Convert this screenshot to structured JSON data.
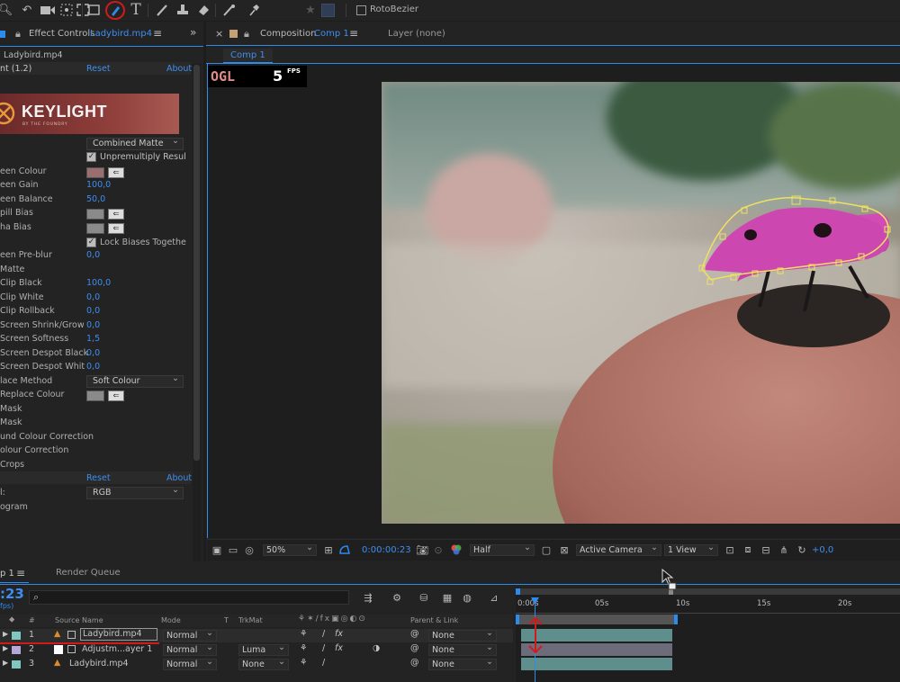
{
  "toolbar": {
    "rotobezier_label": "RotoBezier",
    "tools": [
      "magnify-icon",
      "undo-rotate-icon",
      "camera-icon",
      "pan-behind-icon",
      "anchor-icon",
      "rectangle-icon",
      "pen-icon",
      "type-icon",
      "brush-icon",
      "clone-stamp-icon",
      "eraser-icon",
      "roto-brush-icon",
      "puppet-pin-icon",
      "star-icon"
    ]
  },
  "effect_controls": {
    "tab_title": "Effect Controls",
    "tab_file": "Ladybird.mp4",
    "layer_name": "Ladybird.mp4",
    "effect_name": "nt (1.2)",
    "reset_label": "Reset",
    "about_label": "About",
    "logo_text": "KEYLIGHT",
    "logo_subtext": "BY THE FOUNDRY",
    "view_value": "Combined Matte",
    "unpremultiply_label": "Unpremultiply Resul",
    "rows": [
      {
        "label": "een Colour"
      },
      {
        "label": "een Gain",
        "value": "100,0"
      },
      {
        "label": "een Balance",
        "value": "50,0"
      },
      {
        "label": "pill Bias"
      },
      {
        "label": "ha Bias"
      },
      {
        "label": "Lock Biases Togethe"
      },
      {
        "label": "een Pre-blur",
        "value": "0,0"
      },
      {
        "label": "Matte"
      },
      {
        "label": "Clip Black",
        "value": "100,0"
      },
      {
        "label": "Clip White",
        "value": "0,0"
      },
      {
        "label": "Clip Rollback",
        "value": "0,0"
      },
      {
        "label": "Screen Shrink/Grow",
        "value": "0,0"
      },
      {
        "label": "Screen Softness",
        "value": "1,5"
      },
      {
        "label": "Screen Despot Black",
        "value": "0,0"
      },
      {
        "label": "Screen Despot Whit",
        "value": "0,0"
      },
      {
        "label": "lace Method"
      },
      {
        "label": "Replace Colour"
      },
      {
        "label": "Mask"
      },
      {
        "label": " Mask"
      },
      {
        "label": "und Colour Correction"
      },
      {
        "label": "olour Correction"
      },
      {
        "label": "Crops"
      }
    ],
    "replace_method_value": "Soft Colour",
    "reset2_label": "Reset",
    "about2_label": "About",
    "channel_label": "l:",
    "channel_value": "RGB",
    "histogram_label": "ogram"
  },
  "composition": {
    "close_glyph": "×",
    "tab_title": "Composition",
    "comp_name": "Comp 1",
    "layer_tab": "Layer (none)",
    "breadcrumb": "Comp 1",
    "ogl_label": "OGL",
    "fps_value": "5",
    "fps_unit": "FPS",
    "viewer": {
      "zoom": "50%",
      "timecode": "0:00:00:23",
      "resolution": "Half",
      "camera": "Active Camera",
      "views": "1 View",
      "exposure": "+0,0"
    }
  },
  "timeline": {
    "comp_tab": "p 1",
    "render_queue_tab": "Render Queue",
    "current_time": ":23",
    "fps_note": "fps)",
    "search_placeholder": "",
    "columns": {
      "num": "#",
      "source_name": "Source Name",
      "mode": "Mode",
      "t": "T",
      "trkmat": "TrkMat",
      "parent": "Parent & Link"
    },
    "layers": [
      {
        "num": "1",
        "name": "Ladybird.mp4",
        "mode": "Normal",
        "trkmat": "",
        "parent": "None",
        "label_color": "#7fc8c2"
      },
      {
        "num": "2",
        "name": "Adjustm...ayer 1",
        "mode": "Normal",
        "trkmat": "Luma",
        "parent": "None",
        "label_color": "#b7a6d8"
      },
      {
        "num": "3",
        "name": "Ladybird.mp4",
        "mode": "Normal",
        "trkmat": "None",
        "parent": "None",
        "label_color": "#7fc8c2"
      }
    ],
    "ruler": [
      "0:00s",
      "05s",
      "10s",
      "15s",
      "20s"
    ]
  },
  "colors": {
    "accent_blue": "#2d8ceb",
    "annotation_red": "#d11a1a",
    "mask_yellow": "#f0e060",
    "layer_bar": "#5f8f8c"
  }
}
